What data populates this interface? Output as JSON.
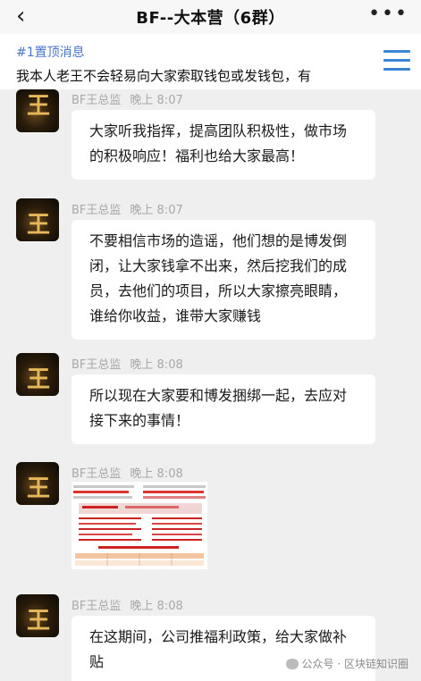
{
  "header": {
    "back_icon": "‹",
    "title": "BF--大本营（6群）",
    "more_icon": "•••"
  },
  "pinned": {
    "tag": "#1置顶消息",
    "text": "我本人老王不会轻易向大家索取钱包或发钱包，有"
  },
  "messages": [
    {
      "sender": "BF王总监",
      "time": "晚上 8:07",
      "text": "大家听我指挥，提高团队积极性，做市场的积极响应！福利也给大家最高！"
    },
    {
      "sender": "BF王总监",
      "time": "晚上 8:07",
      "text": "不要相信市场的造谣，他们想的是博发倒闭，让大家钱拿不出来，然后挖我们的成员，去他们的项目，所以大家擦亮眼睛，谁给你收益，谁带大家赚钱"
    },
    {
      "sender": "BF王总监",
      "time": "晚上 8:08",
      "text": "所以现在大家要和博发捆绑一起，去应对接下来的事情！"
    },
    {
      "sender": "BF王总监",
      "time": "晚上 8:08",
      "image": true
    },
    {
      "sender": "BF王总监",
      "time": "晚上 8:08",
      "text": "在这期间，公司推福利政策，给大家做补贴"
    }
  ],
  "avatar_glyph": "王",
  "watermark": "公众号 · 区块链知识圈",
  "colors": {
    "accent_blue": "#3a85d6",
    "pin_tag": "#4a74c9",
    "background": "#efefef",
    "bubble": "#ffffff"
  }
}
